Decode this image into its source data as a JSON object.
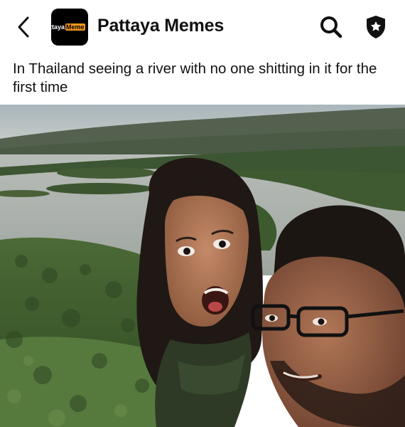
{
  "header": {
    "title": "Pattaya Memes",
    "avatar_logo": {
      "part_a": "ttaya",
      "part_b": "Meme",
      "accent": "#f7971e"
    },
    "icons": {
      "back": "chevron-left-icon",
      "search": "search-icon",
      "shield": "shield-star-icon"
    }
  },
  "post": {
    "caption": "In Thailand seeing a river with no one shitting in it for the first time",
    "photo_colors": {
      "sky": "#b9c2c6",
      "water": "#aeb3b1",
      "forest": "#3e5a2c",
      "hills": "#4a5747"
    }
  }
}
